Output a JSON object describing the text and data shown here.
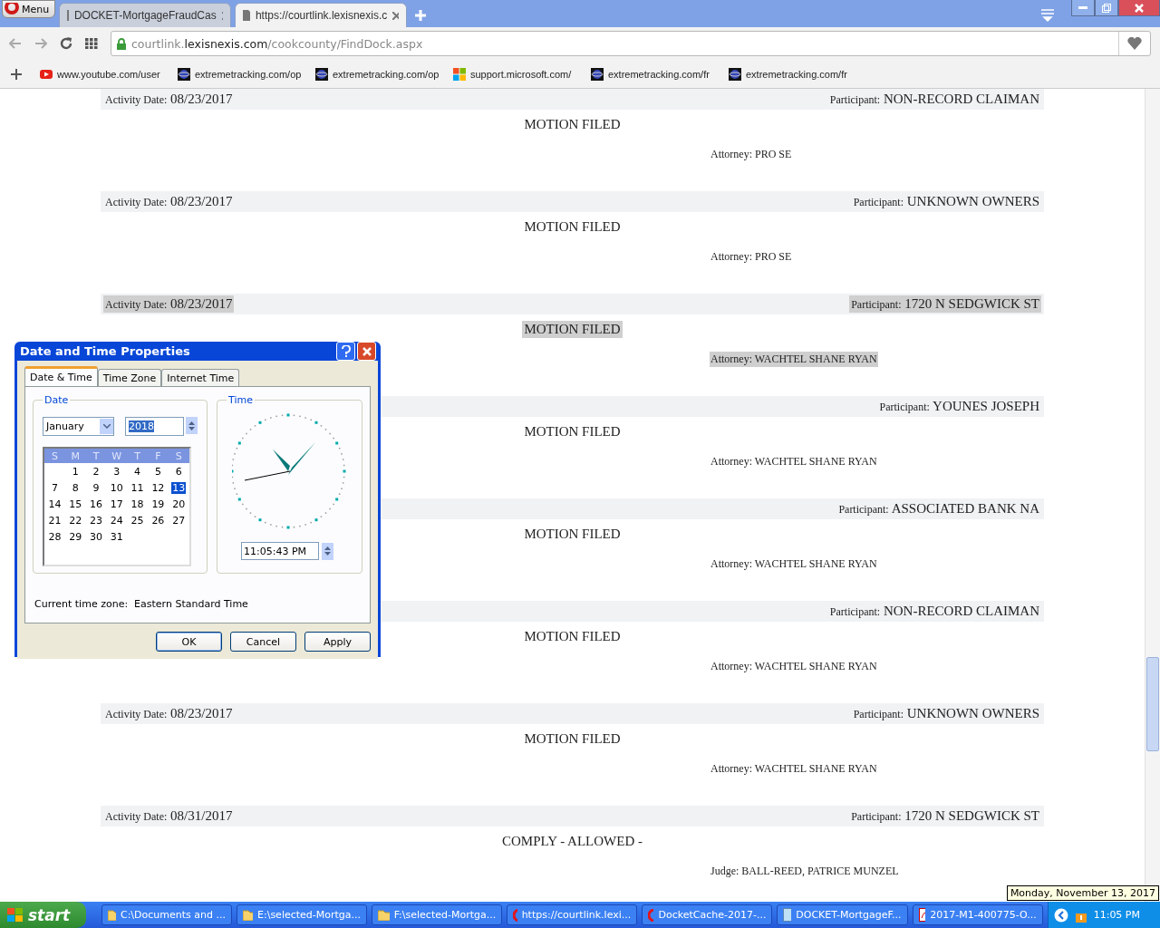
{
  "browser": {
    "menu_label": "Menu",
    "tabs": [
      {
        "title": "DOCKET-MortgageFraudCas",
        "selected": false
      },
      {
        "title": "https://courtlink.lexisnexis.c",
        "selected": true
      }
    ],
    "address": {
      "host_prefix": "courtlink.",
      "host": "lexisnexis.com",
      "path": "/cookcounty/FindDock.aspx"
    },
    "bookmarks": [
      {
        "label": "www.youtube.com/user",
        "kind": "youtube"
      },
      {
        "label": "extremetracking.com/op",
        "kind": "tracker"
      },
      {
        "label": "extremetracking.com/op",
        "kind": "tracker"
      },
      {
        "label": "support.microsoft.com/",
        "kind": "microsoft"
      },
      {
        "label": "extremetracking.com/fr",
        "kind": "tracker"
      },
      {
        "label": "extremetracking.com/fr",
        "kind": "tracker"
      }
    ]
  },
  "docket": [
    {
      "activity_label": "Activity Date:",
      "activity_date": "08/23/2017",
      "participant_label": "Participant:",
      "participant": "NON-RECORD CLAIMAN",
      "event": "MOTION FILED",
      "role_label": "Attorney:",
      "role_value": "PRO SE",
      "highlighted": false
    },
    {
      "activity_label": "Activity Date:",
      "activity_date": "08/23/2017",
      "participant_label": "Participant:",
      "participant": "UNKNOWN OWNERS",
      "event": "MOTION FILED",
      "role_label": "Attorney:",
      "role_value": "PRO SE",
      "highlighted": false
    },
    {
      "activity_label": "Activity Date:",
      "activity_date": "08/23/2017",
      "participant_label": "Participant:",
      "participant": "1720 N SEDGWICK ST",
      "event": "MOTION FILED",
      "role_label": "Attorney:",
      "role_value": "WACHTEL SHANE RYAN",
      "highlighted": true
    },
    {
      "participant_label": "Participant:",
      "participant": "YOUNES JOSEPH",
      "event": "MOTION FILED",
      "role_label": "Attorney:",
      "role_value": "WACHTEL SHANE RYAN",
      "highlighted": false
    },
    {
      "participant_label": "Participant:",
      "participant": "ASSOCIATED BANK NA",
      "event": "MOTION FILED",
      "role_label": "Attorney:",
      "role_value": "WACHTEL SHANE RYAN",
      "highlighted": false
    },
    {
      "participant_label": "Participant:",
      "participant": "NON-RECORD CLAIMAN",
      "event": "MOTION FILED",
      "role_label": "Attorney:",
      "role_value": "WACHTEL SHANE RYAN",
      "highlighted": false
    },
    {
      "activity_label": "Activity Date:",
      "activity_date": "08/23/2017",
      "participant_label": "Participant:",
      "participant": "UNKNOWN OWNERS",
      "event": "MOTION FILED",
      "role_label": "Attorney:",
      "role_value": "WACHTEL SHANE RYAN",
      "highlighted": false
    },
    {
      "activity_label": "Activity Date:",
      "activity_date": "08/31/2017",
      "participant_label": "Participant:",
      "participant": "1720 N SEDGWICK ST",
      "event": "COMPLY - ALLOWED -",
      "role_label": "Judge:",
      "role_value": "BALL-REED, PATRICE MUNZEL",
      "highlighted": false
    }
  ],
  "dialog": {
    "title": "Date and Time Properties",
    "tabs": [
      {
        "label": "Date & Time",
        "selected": true
      },
      {
        "label": "Time Zone",
        "selected": false
      },
      {
        "label": "Internet Time",
        "selected": false
      }
    ],
    "date_group": "Date",
    "month": "January",
    "year": "2018",
    "weekdays": [
      "S",
      "M",
      "T",
      "W",
      "T",
      "F",
      "S"
    ],
    "weeks": [
      [
        {
          "day": "1",
          "selected": false
        },
        {
          "day": "2",
          "selected": false
        },
        {
          "day": "3",
          "selected": false
        },
        {
          "day": "4",
          "selected": false
        },
        {
          "day": "5",
          "selected": false
        },
        {
          "day": "6",
          "selected": false
        }
      ],
      [
        {
          "day": "7",
          "selected": false
        },
        {
          "day": "8",
          "selected": false
        },
        {
          "day": "9",
          "selected": false
        },
        {
          "day": "10",
          "selected": false
        },
        {
          "day": "11",
          "selected": false
        },
        {
          "day": "12",
          "selected": false
        },
        {
          "day": "13",
          "selected": true
        }
      ],
      [
        {
          "day": "14",
          "selected": false
        },
        {
          "day": "15",
          "selected": false
        },
        {
          "day": "16",
          "selected": false
        },
        {
          "day": "17",
          "selected": false
        },
        {
          "day": "18",
          "selected": false
        },
        {
          "day": "19",
          "selected": false
        },
        {
          "day": "20",
          "selected": false
        }
      ],
      [
        {
          "day": "21",
          "selected": false
        },
        {
          "day": "22",
          "selected": false
        },
        {
          "day": "23",
          "selected": false
        },
        {
          "day": "24",
          "selected": false
        },
        {
          "day": "25",
          "selected": false
        },
        {
          "day": "26",
          "selected": false
        },
        {
          "day": "27",
          "selected": false
        }
      ],
      [
        {
          "day": "28",
          "selected": false
        },
        {
          "day": "29",
          "selected": false
        },
        {
          "day": "30",
          "selected": false
        },
        {
          "day": "31",
          "selected": false
        }
      ]
    ],
    "time_group": "Time",
    "time": "11:05:43 PM",
    "timezone_label": "Current time zone:",
    "timezone": "Eastern Standard Time",
    "buttons": [
      "OK",
      "Cancel",
      "Apply"
    ]
  },
  "taskbar": {
    "start": "start",
    "items": [
      {
        "label": "C:\\Documents and ...",
        "kind": "folder"
      },
      {
        "label": "E:\\selected-Mortga...",
        "kind": "folder"
      },
      {
        "label": "F:\\selected-Mortga...",
        "kind": "folder"
      },
      {
        "label": "https://courtlink.lexi...",
        "kind": "opera"
      },
      {
        "label": "DocketCache-2017-...",
        "kind": "opera"
      },
      {
        "label": "DOCKET-MortgageF...",
        "kind": "notepad"
      },
      {
        "label": "2017-M1-400775-O...",
        "kind": "pdf"
      }
    ],
    "clock": "11:05 PM",
    "tooltip": "Monday, November 13, 2017"
  }
}
